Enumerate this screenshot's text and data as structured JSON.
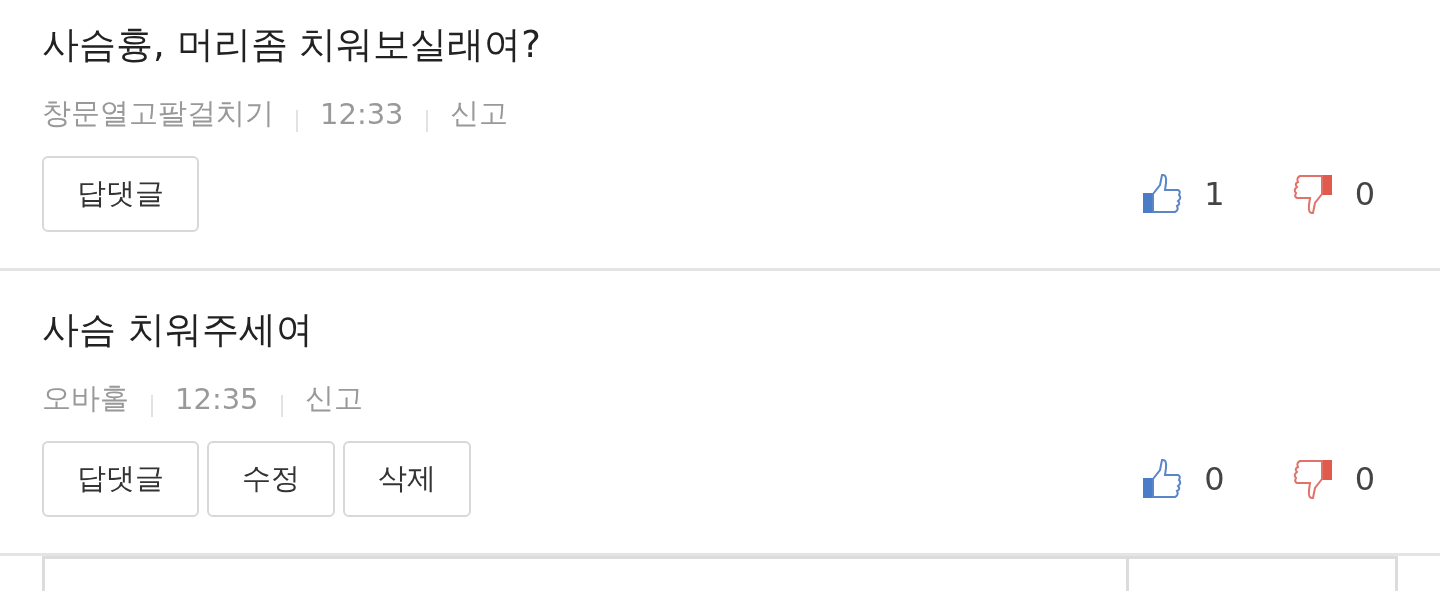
{
  "comments": [
    {
      "title": "사슴흉, 머리좀 치워보실래여?",
      "author": "창문열고팔걸치기",
      "time": "12:33",
      "report": "신고",
      "actions": [
        "답댓글"
      ],
      "likes": "1",
      "dislikes": "0"
    },
    {
      "title": "사슴 치워주세여",
      "author": "오바홀",
      "time": "12:35",
      "report": "신고",
      "actions": [
        "답댓글",
        "수정",
        "삭제"
      ],
      "likes": "0",
      "dislikes": "0"
    }
  ]
}
